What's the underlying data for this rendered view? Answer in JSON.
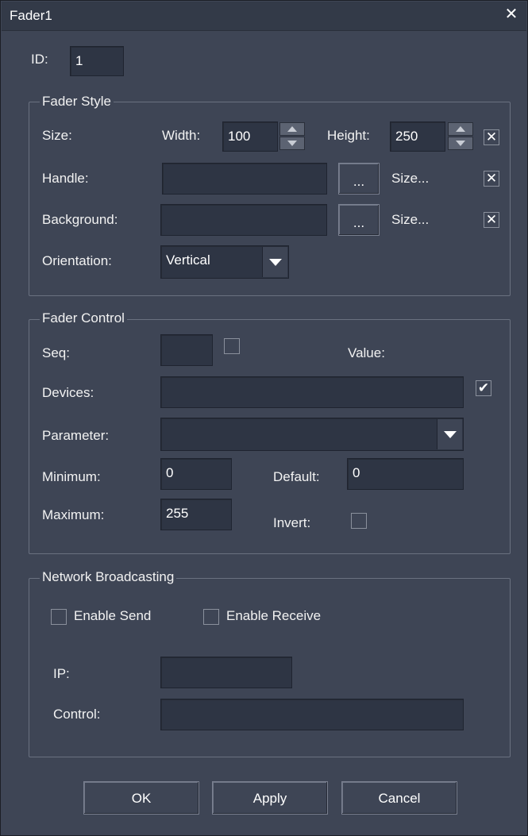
{
  "window": {
    "title": "Fader1",
    "close_glyph": "✕"
  },
  "id_field": {
    "label": "ID:",
    "value": "1"
  },
  "fader_style": {
    "legend": "Fader Style",
    "size_label": "Size:",
    "width_label": "Width:",
    "width_value": "100",
    "height_label": "Height:",
    "height_value": "250",
    "size_checkbox": "✕",
    "handle_label": "Handle:",
    "handle_value": "",
    "handle_browse": "...",
    "handle_size": "Size...",
    "handle_checkbox": "✕",
    "background_label": "Background:",
    "background_value": "",
    "background_browse": "...",
    "background_size": "Size...",
    "background_checkbox": "✕",
    "orientation_label": "Orientation:",
    "orientation_value": "Vertical"
  },
  "fader_control": {
    "legend": "Fader Control",
    "seq_label": "Seq:",
    "seq_value": "",
    "value_label": "Value:",
    "devices_label": "Devices:",
    "devices_value": "",
    "devices_checkbox": "✔",
    "parameter_label": "Parameter:",
    "parameter_value": "",
    "minimum_label": "Minimum:",
    "minimum_value": "0",
    "default_label": "Default:",
    "default_value": "0",
    "maximum_label": "Maximum:",
    "maximum_value": "255",
    "invert_label": "Invert:"
  },
  "network": {
    "legend": "Network Broadcasting",
    "enable_send": "Enable Send",
    "enable_receive": "Enable Receive",
    "ip_label": "IP:",
    "ip_value": "",
    "control_label": "Control:",
    "control_value": ""
  },
  "buttons": {
    "ok": "OK",
    "apply": "Apply",
    "cancel": "Cancel"
  }
}
